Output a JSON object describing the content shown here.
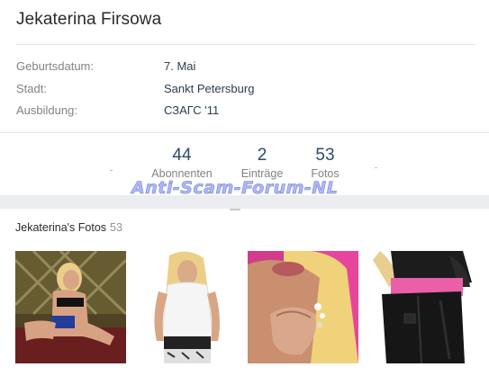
{
  "profile": {
    "name": "Jekaterina Firsowa",
    "info": [
      {
        "label": "Geburtsdatum:",
        "value": "7. Mai"
      },
      {
        "label": "Stadt:",
        "value": "Sankt Petersburg"
      },
      {
        "label": "Ausbildung:",
        "value": "СЗАГС '11"
      }
    ]
  },
  "counters": [
    {
      "count": "44",
      "caption": "Abonnenten"
    },
    {
      "count": "2",
      "caption": "Einträge"
    },
    {
      "count": "53",
      "caption": "Fotos"
    }
  ],
  "watermark": "Anti-Scam-Forum-NL",
  "photos": {
    "title": "Jekaterina's Fotos",
    "count": "53",
    "items": [
      {
        "icon": "photo-1"
      },
      {
        "icon": "photo-2"
      },
      {
        "icon": "photo-3"
      },
      {
        "icon": "photo-4"
      }
    ]
  },
  "colors": {
    "link": "#2b3d52",
    "label": "#828282",
    "watermark": "#6f7fe0"
  }
}
